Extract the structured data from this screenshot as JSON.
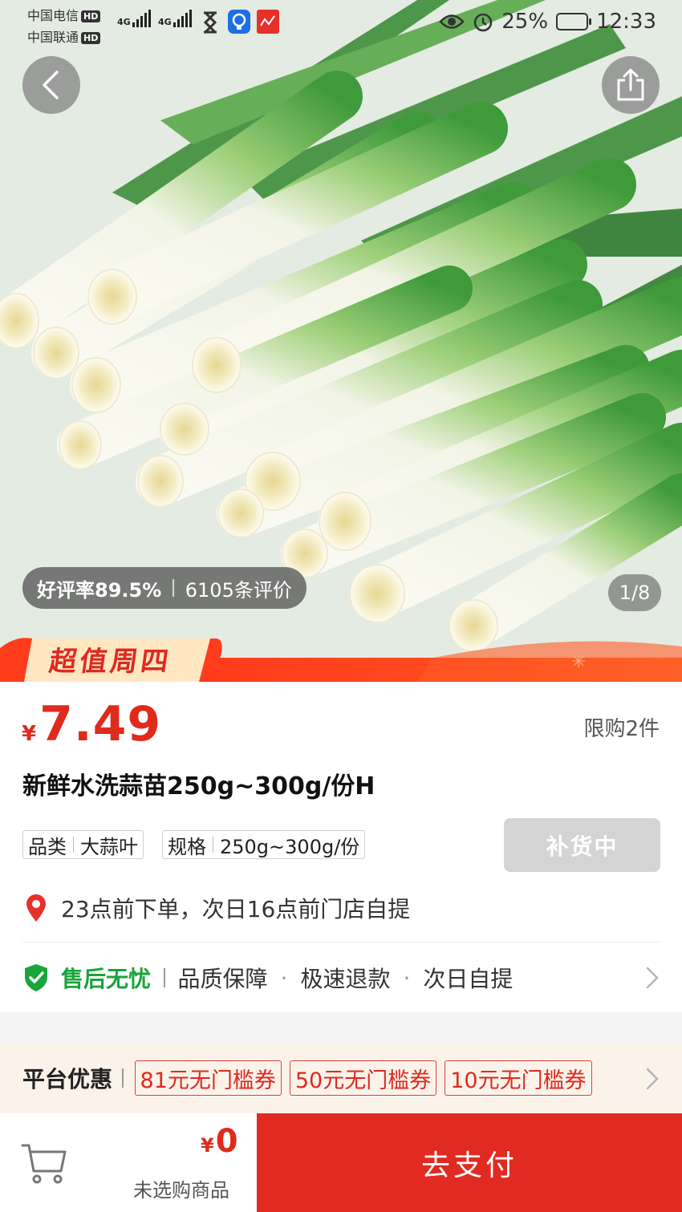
{
  "status_bar": {
    "carrier1": "中国电信",
    "carrier2": "中国联通",
    "hd": "HD",
    "net1": "4G",
    "net2": "4G",
    "battery": "25%",
    "time": "12:33"
  },
  "gallery": {
    "rating_rate": "好评率89.5%",
    "review_count": "6105条评价",
    "page_indicator": "1/8",
    "promo_text": "超值周四"
  },
  "product": {
    "currency": "¥",
    "price": "7.49",
    "purchase_limit": "限购2件",
    "title": "新鲜水洗蒜苗250g~300g/份H",
    "specs": [
      {
        "key": "品类",
        "value": "大蒜叶"
      },
      {
        "key": "规格",
        "value": "250g~300g/份"
      }
    ],
    "restock_label": "补货中",
    "pickup_note": "23点前下单，次日16点前门店自提"
  },
  "aftersale": {
    "title": "售后无忧",
    "items": [
      "品质保障",
      "极速退款",
      "次日自提"
    ]
  },
  "coupons": {
    "label": "平台优惠",
    "items": [
      "81元无门槛券",
      "50元无门槛券",
      "10元无门槛券"
    ]
  },
  "bottom_bar": {
    "currency": "¥",
    "total": "0",
    "selection_note": "未选购商品",
    "pay_label": "去支付"
  },
  "colors": {
    "price_red": "#e02a1b",
    "pay_button": "#e02a22",
    "aftersale_green": "#19a53a",
    "restock_gray": "#d4d4d4"
  }
}
